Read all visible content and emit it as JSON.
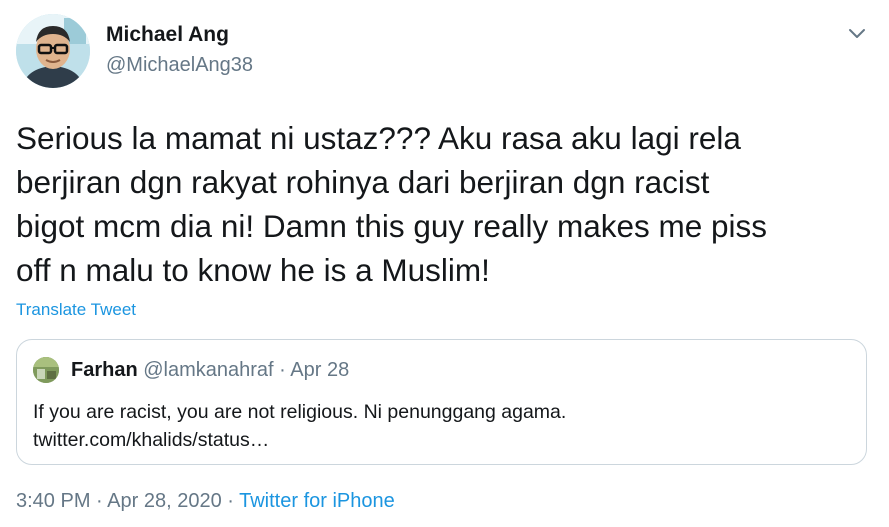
{
  "author": {
    "name": "Michael Ang",
    "handle": "@MichaelAng38",
    "avatar": "avatar-photo"
  },
  "menu_icon": "chevron-down-icon",
  "tweet": {
    "text": "Serious la mamat ni ustaz??? Aku rasa aku lagi rela\nberjiran dgn rakyat rohinya dari berjiran dgn racist\nbigot mcm dia ni! Damn this guy really makes me piss\noff n malu to know he is a Muslim!",
    "translate_label": "Translate Tweet"
  },
  "quoted": {
    "name": "Farhan",
    "handle": "@lamkanahraf",
    "separator": " · ",
    "date": "Apr 28",
    "text": "If you are racist, you are not religious. Ni penunggang agama.",
    "link": "twitter.com/khalids/status…"
  },
  "footer": {
    "time": "3:40 PM",
    "separator1": " · ",
    "date": "Apr 28, 2020",
    "separator2": " · ",
    "source": "Twitter for iPhone"
  },
  "colors": {
    "link": "#1b95e0",
    "secondary_text": "#657786",
    "border": "#ccd6dd"
  }
}
